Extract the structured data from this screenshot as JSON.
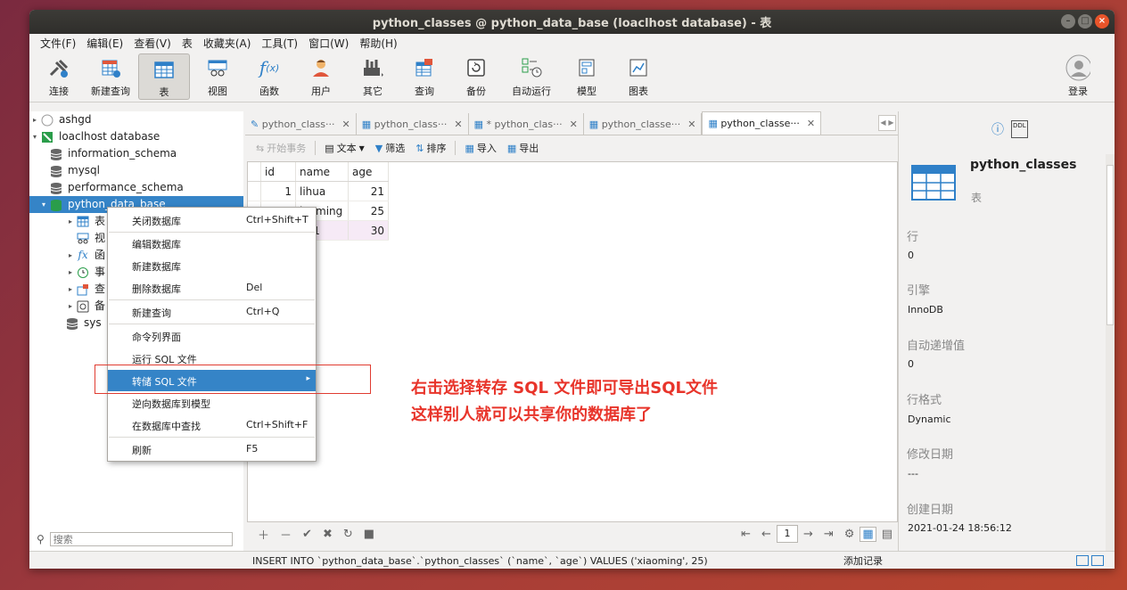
{
  "window": {
    "title": "python_classes @ python_data_base (loaclhost database) - 表"
  },
  "menubar": [
    "文件(F)",
    "编辑(E)",
    "查看(V)",
    "表",
    "收藏夹(A)",
    "工具(T)",
    "窗口(W)",
    "帮助(H)"
  ],
  "toolbar": {
    "connect": "连接",
    "new_query": "新建查询",
    "table": "表",
    "view": "视图",
    "function": "函数",
    "user": "用户",
    "other": "其它",
    "query": "查询",
    "backup": "备份",
    "auto_run": "自动运行",
    "model": "模型",
    "chart": "图表",
    "login": "登录"
  },
  "sidebar": {
    "conn1": "ashgd",
    "conn2": "loaclhost database",
    "dbs": [
      "information_schema",
      "mysql",
      "performance_schema",
      "python_data_base"
    ],
    "children": [
      "表",
      "视",
      "函",
      "事",
      "查",
      "备"
    ],
    "sys": "sys",
    "search_placeholder": "搜索"
  },
  "tabs": [
    "python_class···",
    "python_class···",
    "* python_clas···",
    "python_classe···",
    "python_classe···"
  ],
  "subbar": {
    "begin_tx": "开始事务",
    "text": "文本",
    "filter": "筛选",
    "sort": "排序",
    "import": "导入",
    "export": "导出"
  },
  "table": {
    "columns": [
      "id",
      "name",
      "age"
    ],
    "rows": [
      [
        "1",
        "lihua",
        "21"
      ],
      [
        "",
        "iaoming",
        "25"
      ],
      [
        "",
        "ng1",
        "30"
      ]
    ]
  },
  "pagination": {
    "page": "1"
  },
  "status": {
    "sql": "INSERT INTO `python_data_base`.`python_classes` (`name`, `age`) VALUES ('xiaoming', 25)",
    "add_record": "添加记录"
  },
  "context_menu": [
    {
      "label": "关闭数据库",
      "shortcut": "Ctrl+Shift+T"
    },
    {
      "label": "编辑数据库",
      "shortcut": ""
    },
    {
      "label": "新建数据库",
      "shortcut": ""
    },
    {
      "label": "删除数据库",
      "shortcut": "Del"
    },
    {
      "label": "新建查询",
      "shortcut": "Ctrl+Q"
    },
    {
      "label": "命令列界面",
      "shortcut": ""
    },
    {
      "label": "运行 SQL 文件",
      "shortcut": ""
    },
    {
      "label": "转储 SQL 文件",
      "shortcut": ""
    },
    {
      "label": "逆向数据库到模型",
      "shortcut": ""
    },
    {
      "label": "在数据库中查找",
      "shortcut": "Ctrl+Shift+F"
    },
    {
      "label": "刷新",
      "shortcut": "F5"
    }
  ],
  "right_panel": {
    "name": "python_classes",
    "type": "表",
    "rows_label": "行",
    "rows": "0",
    "engine_label": "引擎",
    "engine": "InnoDB",
    "autoinc_label": "自动递增值",
    "autoinc": "0",
    "rowformat_label": "行格式",
    "rowformat": "Dynamic",
    "modified_label": "修改日期",
    "modified": "---",
    "created_label": "创建日期",
    "created": "2021-01-24 18:56:12"
  },
  "annotation": {
    "line1": "右击选择转存 SQL 文件即可导出SQL文件",
    "line2": "这样别人就可以共享你的数据库了"
  }
}
